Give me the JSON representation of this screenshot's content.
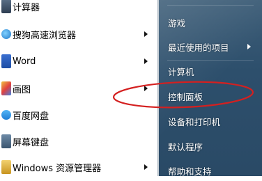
{
  "left_menu": {
    "items": [
      {
        "label": "计算器",
        "icon": "calculator-icon",
        "has_submenu": false
      },
      {
        "label": "搜狗高速浏览器",
        "icon": "sogou-browser-icon",
        "has_submenu": true
      },
      {
        "label": "Word",
        "icon": "word-icon",
        "has_submenu": true
      },
      {
        "label": "画图",
        "icon": "paint-icon",
        "has_submenu": true
      },
      {
        "label": "百度网盘",
        "icon": "baidu-netdisk-icon",
        "has_submenu": false
      },
      {
        "label": "屏幕键盘",
        "icon": "onscreen-keyboard-icon",
        "has_submenu": false
      },
      {
        "label": "Windows 资源管理器",
        "icon": "windows-explorer-icon",
        "has_submenu": true
      }
    ]
  },
  "right_menu": {
    "items": [
      {
        "label": "游戏",
        "has_submenu": false
      },
      {
        "label": "最近使用的项目",
        "has_submenu": true
      },
      {
        "label": "计算机",
        "has_submenu": false
      },
      {
        "label": "控制面板",
        "has_submenu": false,
        "highlighted": true
      },
      {
        "label": "设备和打印机",
        "has_submenu": false
      },
      {
        "label": "默认程序",
        "has_submenu": false
      },
      {
        "label": "帮助和支持",
        "has_submenu": false
      }
    ]
  },
  "colors": {
    "right_pane": "#2d4f6c",
    "annotation_circle": "#d42020"
  }
}
